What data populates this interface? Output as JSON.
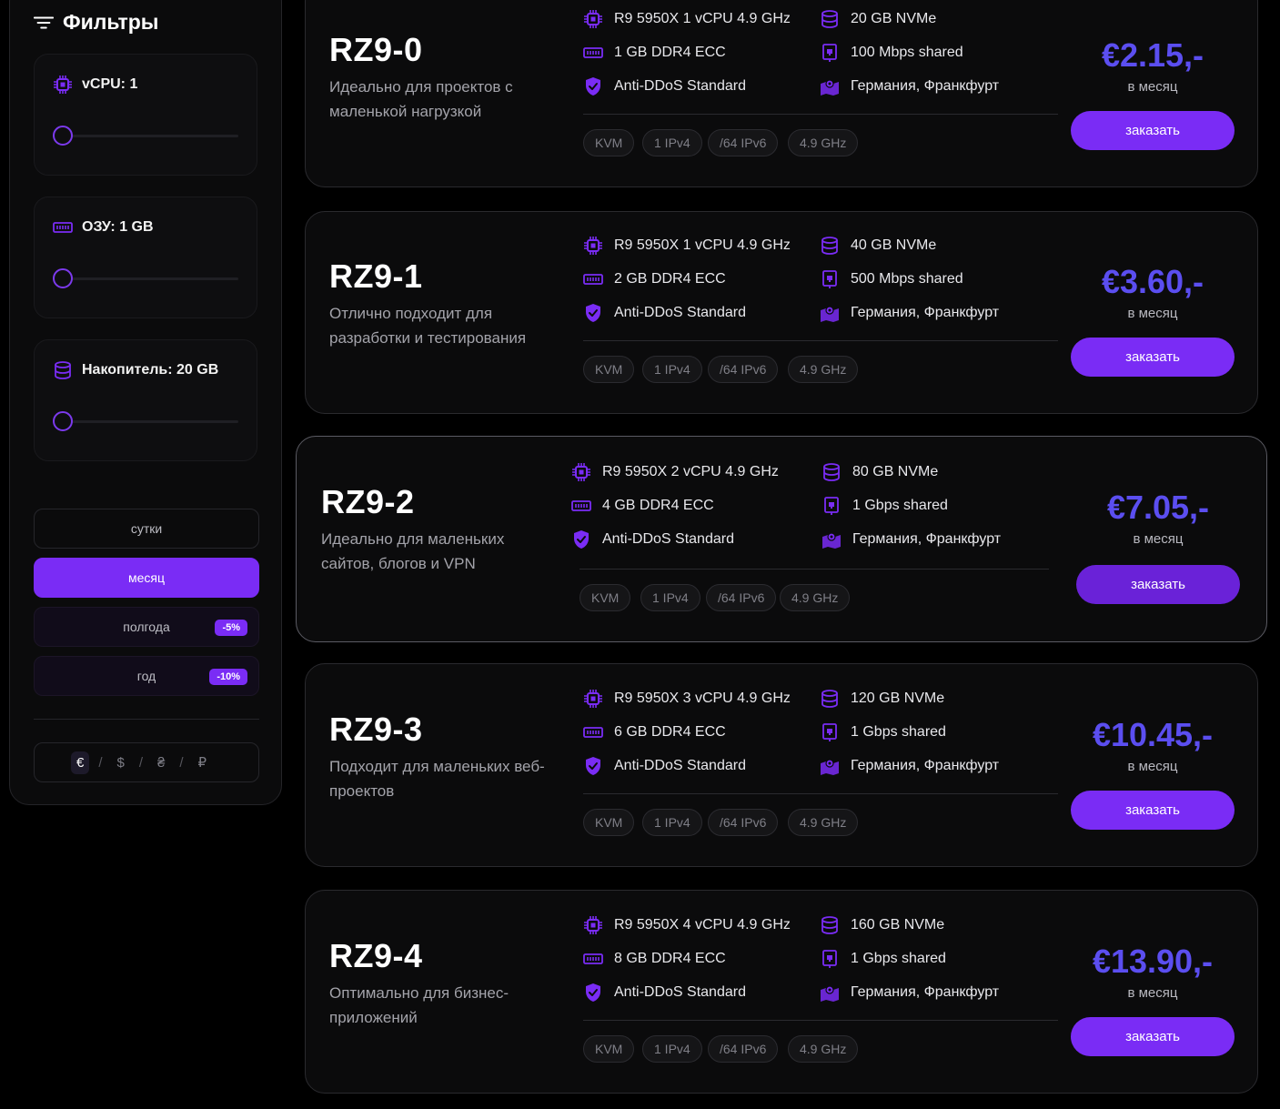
{
  "sidebar": {
    "title": "Фильтры",
    "filters": [
      {
        "label": "vCPU: 1",
        "level": 0
      },
      {
        "label": "ОЗУ: 1 GB",
        "level": 0
      },
      {
        "label": "Накопитель: 20 GB",
        "level": 0
      }
    ],
    "periods": [
      {
        "label": "сутки",
        "discount": ""
      },
      {
        "label": "месяц",
        "discount": ""
      },
      {
        "label": "полгода",
        "discount": "-5%"
      },
      {
        "label": "год",
        "discount": "-10%"
      }
    ],
    "active_period": "месяц",
    "currencies": [
      "€",
      "$",
      "₴",
      "₽"
    ],
    "currency_separator": "/",
    "active_currency": "€"
  },
  "plans": [
    {
      "name": "RZ9-0",
      "desc": "Идеально для проектов с маленькой нагрузкой",
      "cpu": "R9 5950X 1 vCPU 4.9 GHz",
      "ram": "1 GB DDR4 ECC",
      "ddos": "Anti-DDoS Standard",
      "disk": "20 GB NVMe",
      "net": "100 Mbps shared",
      "location": "Германия, Франкфурт",
      "tags": [
        "KVM",
        "1 IPv4",
        "/64 IPv6",
        "4.9 GHz"
      ],
      "price": "€2.15,-",
      "per": "в месяц",
      "button": "заказать"
    },
    {
      "name": "RZ9-1",
      "desc": "Отлично подходит для разработки и тестирования",
      "cpu": "R9 5950X 1 vCPU 4.9 GHz",
      "ram": "2 GB DDR4 ECC",
      "ddos": "Anti-DDoS Standard",
      "disk": "40 GB NVMe",
      "net": "500 Mbps shared",
      "location": "Германия, Франкфурт",
      "tags": [
        "KVM",
        "1 IPv4",
        "/64 IPv6",
        "4.9 GHz"
      ],
      "price": "€3.60,-",
      "per": "в месяц",
      "button": "заказать"
    },
    {
      "name": "RZ9-2",
      "desc": "Идеально для маленьких сайтов, блогов и VPN",
      "cpu": "R9 5950X 2 vCPU 4.9 GHz",
      "ram": "4 GB DDR4 ECC",
      "ddos": "Anti-DDoS Standard",
      "disk": "80 GB NVMe",
      "net": "1 Gbps shared",
      "location": "Германия, Франкфурт",
      "tags": [
        "KVM",
        "1 IPv4",
        "/64 IPv6",
        "4.9 GHz"
      ],
      "price": "€7.05,-",
      "per": "в месяц",
      "button": "заказать"
    },
    {
      "name": "RZ9-3",
      "desc": "Подходит для маленьких веб-проектов",
      "cpu": "R9 5950X 3 vCPU 4.9 GHz",
      "ram": "6 GB DDR4 ECC",
      "ddos": "Anti-DDoS Standard",
      "disk": "120 GB NVMe",
      "net": "1 Gbps shared",
      "location": "Германия, Франкфурт",
      "tags": [
        "KVM",
        "1 IPv4",
        "/64 IPv6",
        "4.9 GHz"
      ],
      "price": "€10.45,-",
      "per": "в месяц",
      "button": "заказать"
    },
    {
      "name": "RZ9-4",
      "desc": "Оптимально для бизнес-приложений",
      "cpu": "R9 5950X 4 vCPU 4.9 GHz",
      "ram": "8 GB DDR4 ECC",
      "ddos": "Anti-DDoS Standard",
      "disk": "160 GB NVMe",
      "net": "1 Gbps shared",
      "location": "Германия, Франкфурт",
      "tags": [
        "KVM",
        "1 IPv4",
        "/64 IPv6",
        "4.9 GHz"
      ],
      "price": "€13.90,-",
      "per": "в месяц",
      "button": "заказать"
    }
  ],
  "colors": {
    "accent": "#7a2cf5",
    "price": "#5b4ef0",
    "background": "#000000",
    "card": "#0b0b0c"
  },
  "icons": {
    "filters": "sliders-icon",
    "cpu": "cpu-icon",
    "ram": "ram-icon",
    "disk": "database-icon",
    "network": "network-port-icon",
    "ddos": "shield-check-icon",
    "location": "map-pin-icon"
  }
}
